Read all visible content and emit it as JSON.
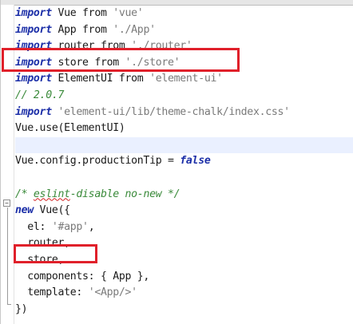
{
  "lines": [
    [
      {
        "t": "import",
        "c": "kw"
      },
      {
        "t": " Vue from ",
        "c": ""
      },
      {
        "t": "'vue'",
        "c": "str"
      }
    ],
    [
      {
        "t": "import",
        "c": "kw"
      },
      {
        "t": " App from ",
        "c": ""
      },
      {
        "t": "'./App'",
        "c": "str"
      }
    ],
    [
      {
        "t": "import",
        "c": "kw"
      },
      {
        "t": " router from ",
        "c": ""
      },
      {
        "t": "'./router'",
        "c": "str"
      }
    ],
    [
      {
        "t": "import",
        "c": "kw"
      },
      {
        "t": " store from ",
        "c": ""
      },
      {
        "t": "'./store'",
        "c": "str"
      }
    ],
    [
      {
        "t": "import",
        "c": "kw"
      },
      {
        "t": " ElementUI from ",
        "c": ""
      },
      {
        "t": "'element-ui'",
        "c": "str"
      }
    ],
    [
      {
        "t": "// 2.0.7",
        "c": "cm"
      }
    ],
    [
      {
        "t": "import",
        "c": "kw"
      },
      {
        "t": " ",
        "c": ""
      },
      {
        "t": "'element-ui/lib/theme-chalk/index.css'",
        "c": "str"
      }
    ],
    [
      {
        "t": "Vue.use(ElementUI)",
        "c": ""
      }
    ],
    [],
    [
      {
        "t": "Vue.config.productionTip = ",
        "c": ""
      },
      {
        "t": "false",
        "c": "lit"
      }
    ],
    [],
    [
      {
        "t": "/* ",
        "c": "cm"
      },
      {
        "t": "eslint",
        "c": "cm squiggle"
      },
      {
        "t": "-disable no-new */",
        "c": "cm"
      }
    ],
    [
      {
        "t": "new",
        "c": "kw"
      },
      {
        "t": " Vue({",
        "c": ""
      }
    ],
    [
      {
        "t": "  el: ",
        "c": ""
      },
      {
        "t": "'#app'",
        "c": "str"
      },
      {
        "t": ",",
        "c": ""
      }
    ],
    [
      {
        "t": "  router,",
        "c": ""
      }
    ],
    [
      {
        "t": "  store,",
        "c": ""
      }
    ],
    [
      {
        "t": "  components: { App },",
        "c": ""
      }
    ],
    [
      {
        "t": "  template: ",
        "c": ""
      },
      {
        "t": "'<App/>'",
        "c": "str"
      }
    ],
    [
      {
        "t": "})",
        "c": ""
      }
    ]
  ],
  "highlighted_line": 8,
  "fold_icon": "minus-box-icon",
  "highlight_boxes": [
    "import-store-line",
    "store-property-line"
  ],
  "colors": {
    "keyword": "#1c2fa8",
    "string": "#7a7a7a",
    "comment": "#3a8a3a",
    "annotation_box": "#e0202a",
    "current_line": "#eaf0ff"
  }
}
